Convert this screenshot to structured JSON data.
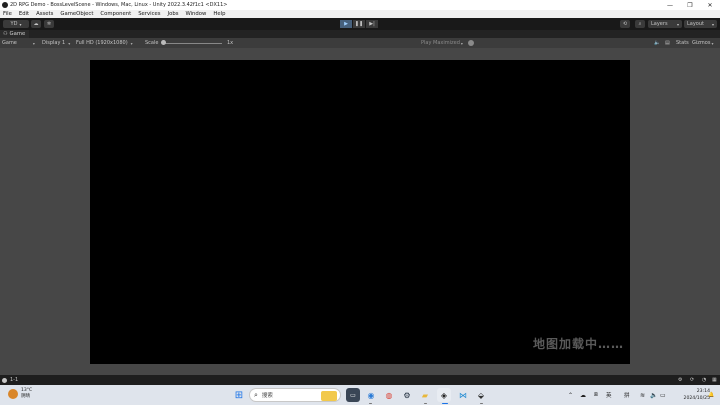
{
  "window": {
    "title": "2D RPG Demo - BossLevelScene - Windows, Mac, Linux - Unity 2022.3.42f1c1 <DX11>",
    "minimize": "—",
    "maximize": "❐",
    "close": "✕"
  },
  "menu": [
    "File",
    "Edit",
    "Assets",
    "GameObject",
    "Component",
    "Services",
    "Jobs",
    "Window",
    "Help"
  ],
  "toolbar": {
    "account": "YD",
    "cloud_icon": "cloud-icon",
    "collab_icon": "collab-icon",
    "play": "▶",
    "pause": "❚❚",
    "step": "▶|",
    "history_icon": "history-icon",
    "search_icon": "search-icon",
    "layers": "Layers",
    "layout": "Layout"
  },
  "tab": {
    "label": "Game",
    "icon": "gamepad-icon"
  },
  "game_toolbar": {
    "view_mode": "Game",
    "display": "Display 1",
    "resolution": "Full HD (1920x1080)",
    "scale_label": "Scale",
    "scale_value": "1x",
    "play_mode": "Play Maximized",
    "stats": "Stats",
    "gizmos": "Gizmos"
  },
  "game_view": {
    "loading_text": "地图加载中……"
  },
  "status_bar": {
    "message": "1-1"
  },
  "taskbar": {
    "weather_temp": "13°C",
    "weather_desc": "阴晴",
    "search_placeholder": "搜索",
    "tray_lang": "英",
    "tray_ime": "拼",
    "time": "23:14",
    "date": "2024/10/25"
  },
  "colors": {
    "editor_bg": "#474747",
    "game_screen": "#000000",
    "play_active": "#46607c",
    "taskbar_bg": "#dfe4ec"
  }
}
